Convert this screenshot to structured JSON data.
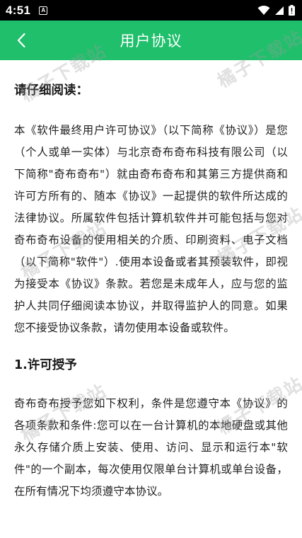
{
  "status_bar": {
    "time": "4:51",
    "notification_glyph": "A",
    "icons": [
      "wifi-icon",
      "signal-icon",
      "battery-icon"
    ]
  },
  "app_bar": {
    "title": "用户协议",
    "back_icon": "chevron-left-icon",
    "color": "#1fbf6b"
  },
  "content": {
    "intro_heading": "请仔细阅读：",
    "intro_paragraph": "本《软件最终用户许可协议》（以下简称《协议》）是您（个人或单一实体）与北京奇布奇布科技有限公司（以下简称\"奇布奇布\"）就由奇布奇布和其第三方提供商和许可方所有的、随本《协议》一起提供的软件所达成的法律协议。所属软件包括计算机软件并可能包括与您对奇布奇布设备的使用相关的介质、印刷资料、电子文档（以下简称\"软件\"）.使用本设备或者其预装软件，即视为接受本《协议》条款。若您是未成年人，应与您的监护人共同仔细阅读本协议，并取得监护人的同意。如果您不接受协议条款，请勿使用本设备或软件。",
    "section1_heading": "1.许可授予",
    "section1_paragraph": "奇布奇布授予您如下权利，条件是您遵守本《协议》的各项条款和条件:您可以在一台计算机的本地硬盘或其他永久存储介质上安装、使用、访问、显示和运行本\"软件\"的一个副本，每次使用仅限单台计算机或单台设备，在所有情况下均须遵守本协议。"
  },
  "watermark": {
    "text": "橘子下载站"
  }
}
